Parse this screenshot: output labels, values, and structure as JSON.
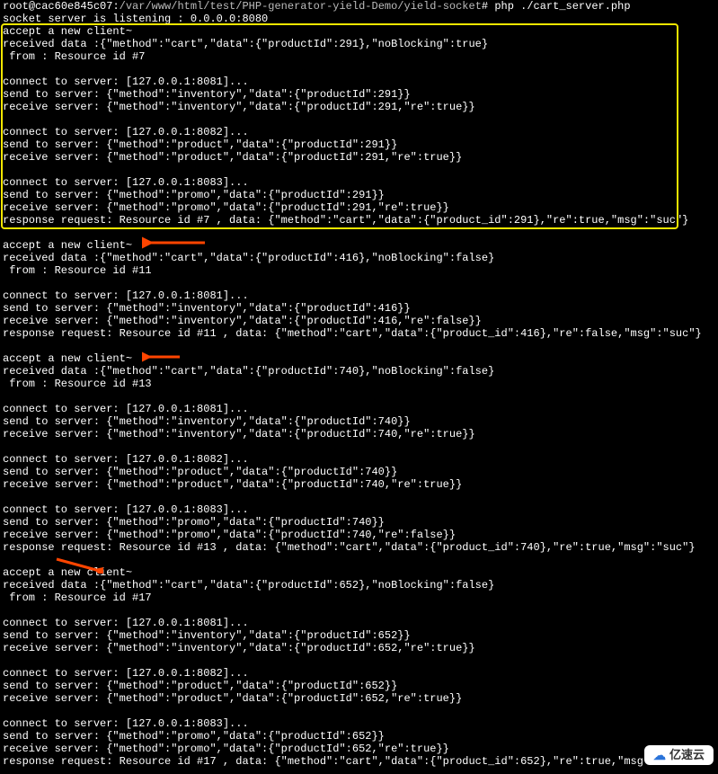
{
  "prompt": {
    "user": "root",
    "host": "cac60e845c07",
    "path": "/var/www/html/test/PHP-generator-yield-Demo/yield-socket",
    "command": "php ./cart_server.php"
  },
  "listening": "socket server is listening : 0.0.0.0:8080",
  "box_lines": [
    "accept a new client~",
    "received data :{\"method\":\"cart\",\"data\":{\"productId\":291},\"noBlocking\":true}",
    " from : Resource id #7",
    "",
    "connect to server: [127.0.0.1:8081]...",
    "send to server: {\"method\":\"inventory\",\"data\":{\"productId\":291}}",
    "receive server: {\"method\":\"inventory\",\"data\":{\"productId\":291,\"re\":true}}",
    "",
    "connect to server: [127.0.0.1:8082]...",
    "send to server: {\"method\":\"product\",\"data\":{\"productId\":291}}",
    "receive server: {\"method\":\"product\",\"data\":{\"productId\":291,\"re\":true}}",
    "",
    "connect to server: [127.0.0.1:8083]...",
    "send to server: {\"method\":\"promo\",\"data\":{\"productId\":291}}",
    "receive server: {\"method\":\"promo\",\"data\":{\"productId\":291,\"re\":true}}",
    "response request: Resource id #7 , data: {\"method\":\"cart\",\"data\":{\"product_id\":291},\"re\":true,\"msg\":\"suc\"}"
  ],
  "rest_lines": [
    "",
    "accept a new client~",
    "received data :{\"method\":\"cart\",\"data\":{\"productId\":416},\"noBlocking\":false}",
    " from : Resource id #11",
    "",
    "connect to server: [127.0.0.1:8081]...",
    "send to server: {\"method\":\"inventory\",\"data\":{\"productId\":416}}",
    "receive server: {\"method\":\"inventory\",\"data\":{\"productId\":416,\"re\":false}}",
    "response request: Resource id #11 , data: {\"method\":\"cart\",\"data\":{\"product_id\":416},\"re\":false,\"msg\":\"suc\"}",
    "",
    "accept a new client~",
    "received data :{\"method\":\"cart\",\"data\":{\"productId\":740},\"noBlocking\":false}",
    " from : Resource id #13",
    "",
    "connect to server: [127.0.0.1:8081]...",
    "send to server: {\"method\":\"inventory\",\"data\":{\"productId\":740}}",
    "receive server: {\"method\":\"inventory\",\"data\":{\"productId\":740,\"re\":true}}",
    "",
    "connect to server: [127.0.0.1:8082]...",
    "send to server: {\"method\":\"product\",\"data\":{\"productId\":740}}",
    "receive server: {\"method\":\"product\",\"data\":{\"productId\":740,\"re\":true}}",
    "",
    "connect to server: [127.0.0.1:8083]...",
    "send to server: {\"method\":\"promo\",\"data\":{\"productId\":740}}",
    "receive server: {\"method\":\"promo\",\"data\":{\"productId\":740,\"re\":false}}",
    "response request: Resource id #13 , data: {\"method\":\"cart\",\"data\":{\"product_id\":740},\"re\":true,\"msg\":\"suc\"}",
    "",
    "accept a new client~",
    "received data :{\"method\":\"cart\",\"data\":{\"productId\":652},\"noBlocking\":false}",
    " from : Resource id #17",
    "",
    "connect to server: [127.0.0.1:8081]...",
    "send to server: {\"method\":\"inventory\",\"data\":{\"productId\":652}}",
    "receive server: {\"method\":\"inventory\",\"data\":{\"productId\":652,\"re\":true}}",
    "",
    "connect to server: [127.0.0.1:8082]...",
    "send to server: {\"method\":\"product\",\"data\":{\"productId\":652}}",
    "receive server: {\"method\":\"product\",\"data\":{\"productId\":652,\"re\":true}}",
    "",
    "connect to server: [127.0.0.1:8083]...",
    "send to server: {\"method\":\"promo\",\"data\":{\"productId\":652}}",
    "receive server: {\"method\":\"promo\",\"data\":{\"productId\":652,\"re\":true}}",
    "response request: Resource id #17 , data: {\"method\":\"cart\",\"data\":{\"product_id\":652},\"re\":true,\"msg\":"
  ],
  "watermark": {
    "text": "亿速云"
  }
}
